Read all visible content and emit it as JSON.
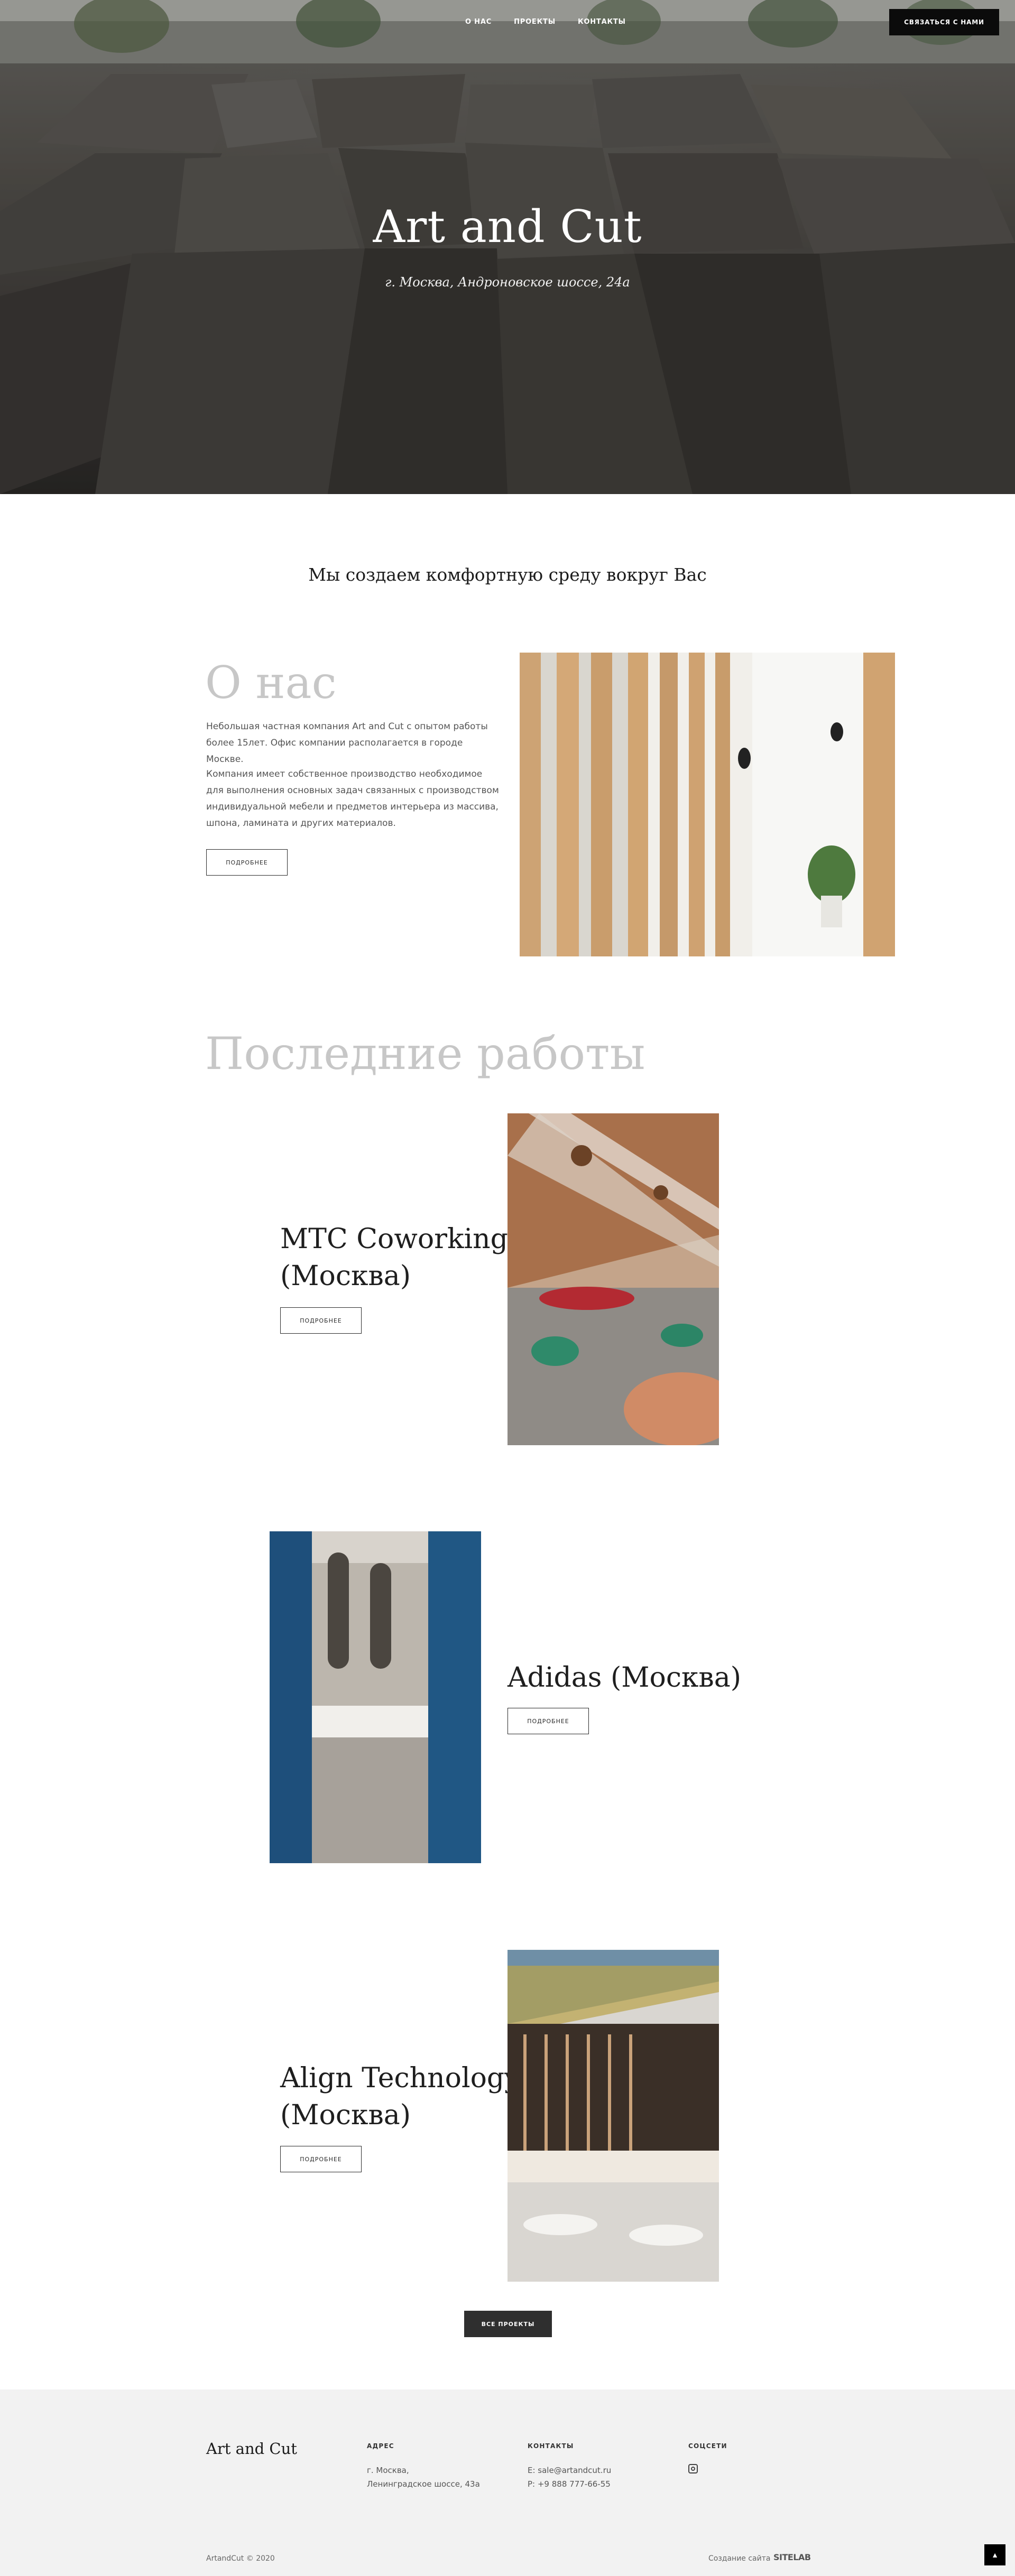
{
  "header": {
    "nav": [
      "О нас",
      "Проекты",
      "Контакты"
    ],
    "contact_button": "Связаться с нами"
  },
  "hero": {
    "title": "Art and Cut",
    "subtitle": "г. Москва, Андроновское шоссе, 24а"
  },
  "intro": {
    "tagline": "Мы создаем комфортную среду вокруг Вас"
  },
  "about": {
    "title": "О нас",
    "paragraph1": "Небольшая частная компания Art and Cut с опытом работы более 15лет. Офис компании располагается в городе Москве.",
    "paragraph2": "Компания имеет собственное производство необходимое для выполнения основных задач связанных с производством индивидуальной мебели и предметов интерьера из массива, шпона, ламината и других материалов.",
    "more_button": "Подробнее"
  },
  "works": {
    "title": "Последние работы",
    "projects": [
      {
        "title_line1": "MTC Coworking",
        "title_line2": "(Москва)",
        "more_button": "Подробнее"
      },
      {
        "title": "Adidas (Москва)",
        "more_button": "Подробнее"
      },
      {
        "title_line1": "Align Technology Inc.",
        "title_line2": "(Москва)",
        "more_button": "Подробнее"
      }
    ],
    "all_projects_button": "Все проекты"
  },
  "footer": {
    "brand": "Art and Cut",
    "address_heading": "Адрес",
    "address_line1": "г. Москва,",
    "address_line2": "Ленинградское шоссе, 43а",
    "contacts_heading": "Контакты",
    "email": "E: sale@artandcut.ru",
    "phone": "P: +9 888 777-66-55",
    "social_heading": "Соцсети",
    "social_icon": "instagram-icon",
    "copyright": "ArtandCut © 2020",
    "made_by_label": "Создание сайта",
    "made_by_logo": "SITELAB"
  },
  "colors": {
    "accent_dark": "#0b0b0b",
    "muted_heading": "#c7c7c7",
    "footer_bg": "#f2f2f2"
  }
}
